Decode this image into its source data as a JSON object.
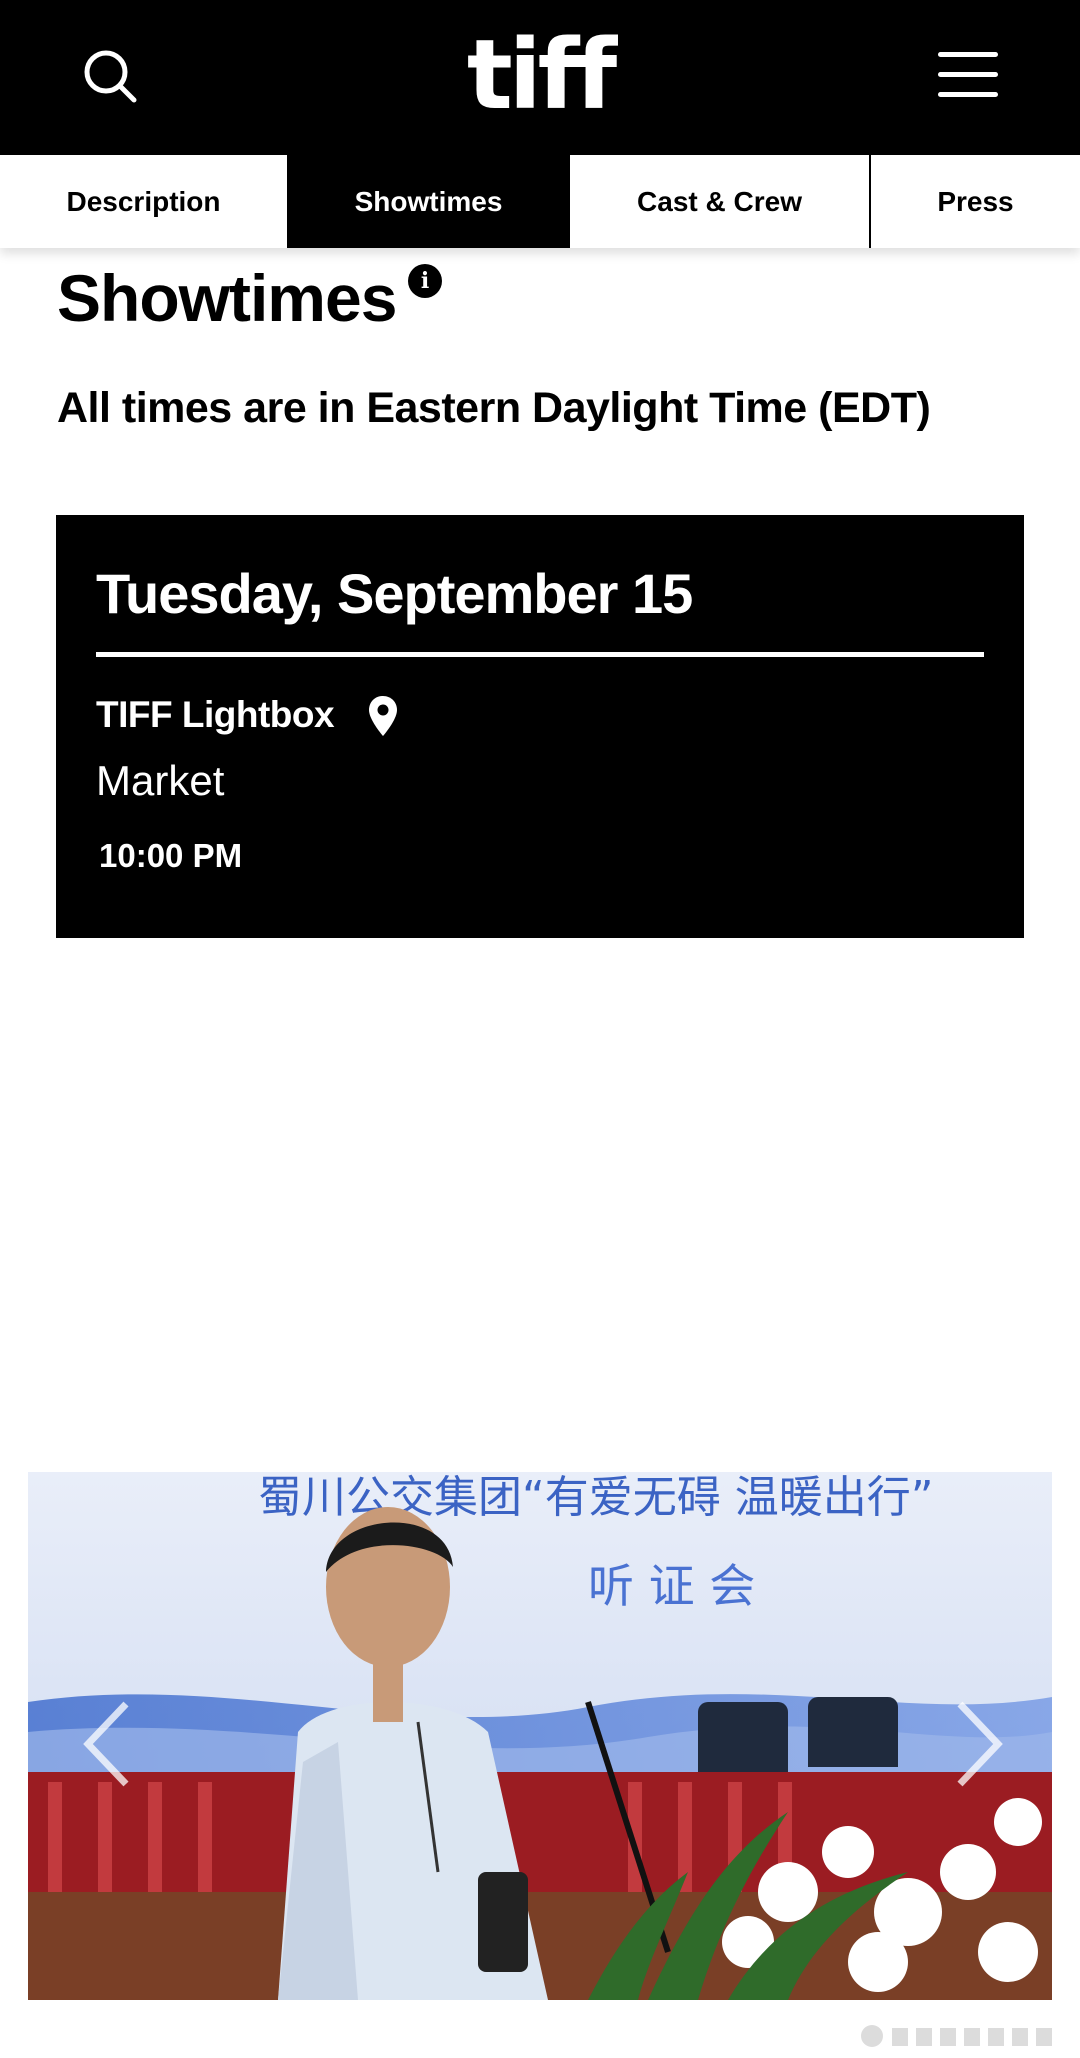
{
  "header": {
    "logo": "tiff",
    "search_icon": "search-icon",
    "menu_icon": "hamburger-menu-icon",
    "background": "#000000"
  },
  "tabs": [
    {
      "label": "Description",
      "active": false
    },
    {
      "label": "Showtimes",
      "active": true
    },
    {
      "label": "Cast & Crew",
      "active": false
    },
    {
      "label": "Press",
      "active": false
    }
  ],
  "page": {
    "title": "Showtimes",
    "info_icon": "info-icon",
    "info_glyph": "i",
    "timezone_note": "All times are in Eastern Daylight Time (EDT)"
  },
  "showtime": {
    "date": "Tuesday, September 15",
    "venue": "TIFF Lightbox",
    "venue_icon": "location-pin-icon",
    "program": "Market",
    "time": "10:00 PM"
  },
  "gallery": {
    "prev_icon": "chevron-left-icon",
    "next_icon": "chevron-right-icon",
    "banner_line1": "蜀川公交集团“有爱无碍 温暖出行”",
    "banner_line2": "听 证 会"
  }
}
